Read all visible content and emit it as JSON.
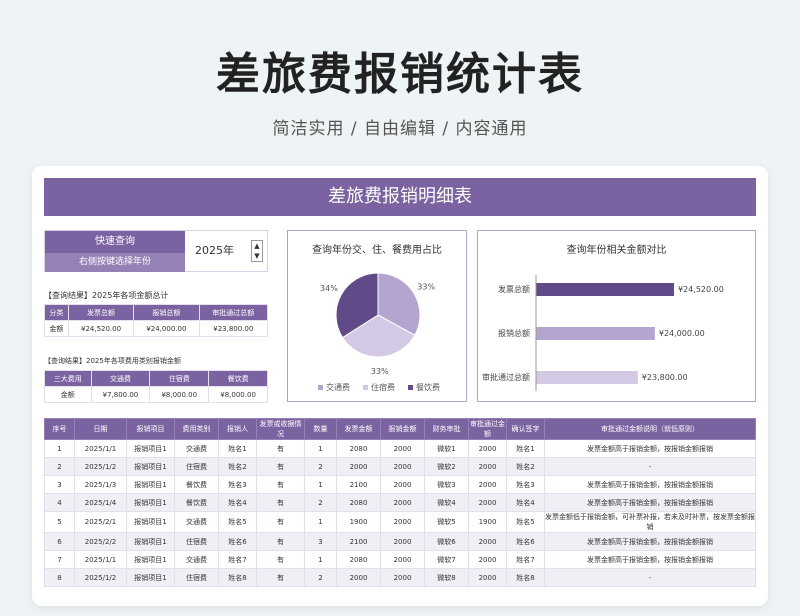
{
  "hero": {
    "title": "差旅费报销统计表",
    "subtitle": "简洁实用 / 自由编辑 / 内容通用"
  },
  "banner": "差旅费报销明细表",
  "quick_query": {
    "title": "快速查询",
    "hint": "右侧按键选择年份",
    "year": "2025年"
  },
  "summary1": {
    "caption": "【查询结果】2025年各项金额总计",
    "headers": [
      "分类",
      "发票总额",
      "报销总额",
      "审批通过总额"
    ],
    "row": [
      "金额",
      "¥24,520.00",
      "¥24,000.00",
      "¥23,800.00"
    ]
  },
  "summary2": {
    "caption": "【查询结果】2025年各项费用类别报销金额",
    "headers": [
      "三大费用",
      "交通费",
      "住宿费",
      "餐饮费"
    ],
    "row": [
      "金额",
      "¥7,800.00",
      "¥8,000.00",
      "¥8,000.00"
    ]
  },
  "chart_data": [
    {
      "type": "pie",
      "title": "查询年份交、住、餐费用占比",
      "categories": [
        "交通费",
        "住宿费",
        "餐饮费"
      ],
      "values": [
        33,
        33,
        34
      ],
      "labels": [
        "33%",
        "33%",
        "34%"
      ],
      "colors": [
        "#b3a5cf",
        "#d3c9e4",
        "#604a87"
      ],
      "legend": "bottom"
    },
    {
      "type": "bar",
      "orientation": "horizontal",
      "title": "查询年份相关金额对比",
      "categories": [
        "发票总额",
        "报销总额",
        "审批通过总额"
      ],
      "values": [
        24520,
        24000,
        23800
      ],
      "labels": [
        "¥24,520.00",
        "¥24,000.00",
        "¥23,800.00"
      ],
      "colors": [
        "#604a87",
        "#b3a5cf",
        "#d3c9e4"
      ]
    }
  ],
  "detail": {
    "headers": [
      "序号",
      "日期",
      "报销项目",
      "费用类别",
      "报销人",
      "发票或收据情况",
      "数量",
      "发票金额",
      "报销金额",
      "财务审批",
      "审批通过金额",
      "确认签字",
      "审批通过金额说明（就低原则）"
    ],
    "rows": [
      [
        "1",
        "2025/1/1",
        "报销项目1",
        "交通费",
        "姓名1",
        "有",
        "1",
        "2080",
        "2000",
        "微软1",
        "2000",
        "姓名1",
        "发票金额高于报销金额，按报销金额报销"
      ],
      [
        "2",
        "2025/1/2",
        "报销项目1",
        "住宿费",
        "姓名2",
        "有",
        "2",
        "2000",
        "2000",
        "微软2",
        "2000",
        "姓名2",
        "-"
      ],
      [
        "3",
        "2025/1/3",
        "报销项目1",
        "餐饮费",
        "姓名3",
        "有",
        "1",
        "2100",
        "2000",
        "微软3",
        "2000",
        "姓名3",
        "发票金额高于报销金额，按报销金额报销"
      ],
      [
        "4",
        "2025/1/4",
        "报销项目1",
        "餐饮费",
        "姓名4",
        "有",
        "2",
        "2080",
        "2000",
        "微软4",
        "2000",
        "姓名4",
        "发票金额高于报销金额，按报销金额报销"
      ],
      [
        "5",
        "2025/2/1",
        "报销项目1",
        "交通费",
        "姓名5",
        "有",
        "1",
        "1900",
        "2000",
        "微软5",
        "1900",
        "姓名5",
        "发票金额低于报销金额，可补票补报，若未及时补票，按发票金额报销"
      ],
      [
        "6",
        "2025/2/2",
        "报销项目1",
        "住宿费",
        "姓名6",
        "有",
        "3",
        "2100",
        "2000",
        "微软6",
        "2000",
        "姓名6",
        "发票金额高于报销金额，按报销金额报销"
      ],
      [
        "7",
        "2025/1/1",
        "报销项目1",
        "交通费",
        "姓名7",
        "有",
        "1",
        "2080",
        "2000",
        "微软7",
        "2000",
        "姓名7",
        "发票金额高于报销金额，按报销金额报销"
      ],
      [
        "8",
        "2025/1/2",
        "报销项目1",
        "住宿费",
        "姓名8",
        "有",
        "2",
        "2000",
        "2000",
        "微软8",
        "2000",
        "姓名8",
        "-"
      ]
    ]
  }
}
